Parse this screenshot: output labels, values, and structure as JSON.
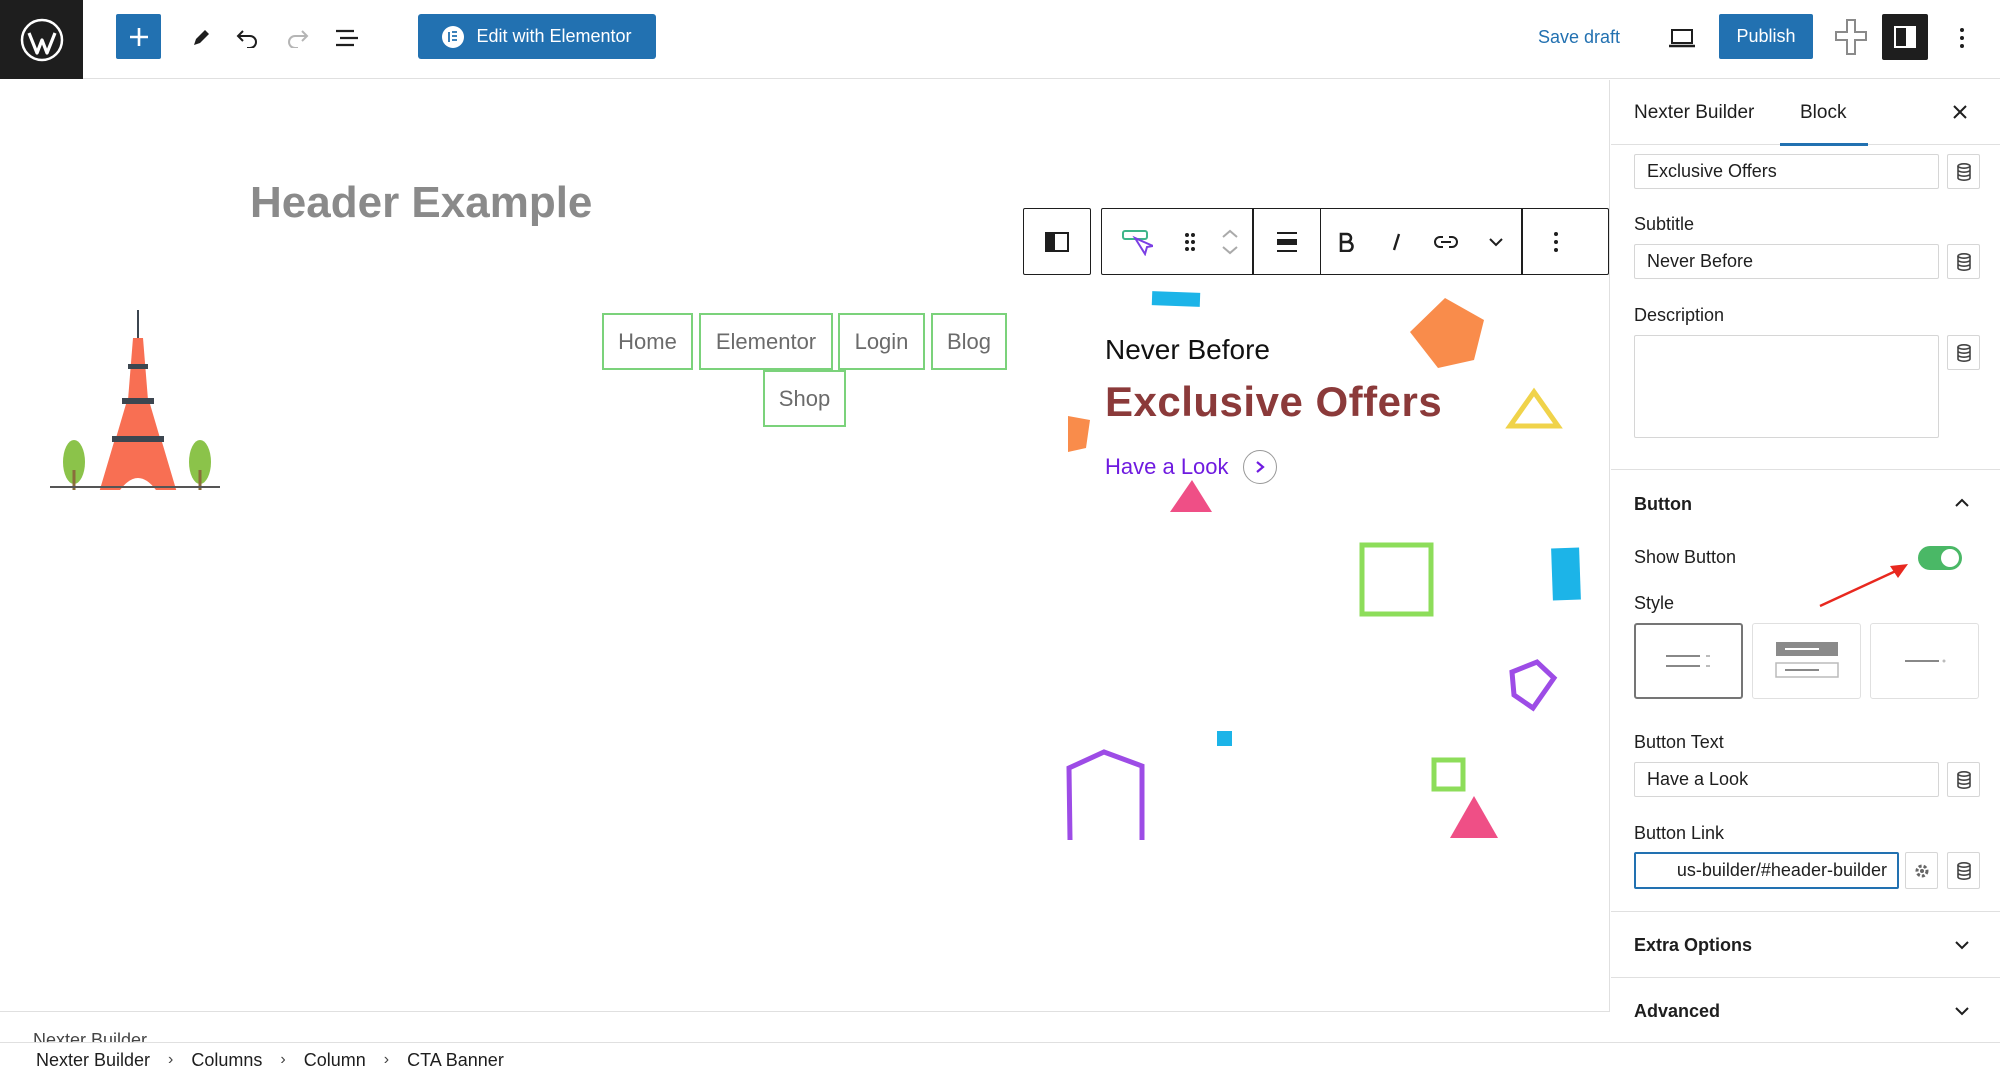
{
  "topbar": {
    "edit_with_elementor": "Edit with Elementor",
    "save_draft": "Save draft",
    "publish": "Publish"
  },
  "canvas": {
    "header_title": "Header Example",
    "nav": [
      "Home",
      "Elementor",
      "Login",
      "Blog",
      "Shop"
    ],
    "cta": {
      "subtitle": "Never Before",
      "title": "Exclusive Offers",
      "button_text": "Have a Look"
    },
    "bottom_panel_label": "Nexter Builder"
  },
  "breadcrumb": [
    "Nexter Builder",
    "Columns",
    "Column",
    "CTA Banner"
  ],
  "sidebar": {
    "tabs": [
      "Nexter Builder",
      "Block"
    ],
    "active_tab": "Block",
    "title_value": "Exclusive Offers",
    "subtitle_label": "Subtitle",
    "subtitle_value": "Never Before",
    "description_label": "Description",
    "description_value": "",
    "button_section": "Button",
    "show_button_label": "Show Button",
    "show_button_on": true,
    "style_label": "Style",
    "style_options": [
      "style-1",
      "style-2",
      "style-3"
    ],
    "selected_style": "style-1",
    "button_text_label": "Button Text",
    "button_text_value": "Have a Look",
    "button_link_label": "Button Link",
    "button_link_value": "us-builder/#header-builder",
    "extra_options": "Extra Options",
    "advanced": "Advanced"
  },
  "colors": {
    "accent": "#2271b1",
    "toggle_on": "#4ab866",
    "cta_title": "#8b3a3a",
    "cta_link": "#6f1be0",
    "nav_border": "#7bd27b",
    "annotation_arrow": "#e8281f"
  }
}
